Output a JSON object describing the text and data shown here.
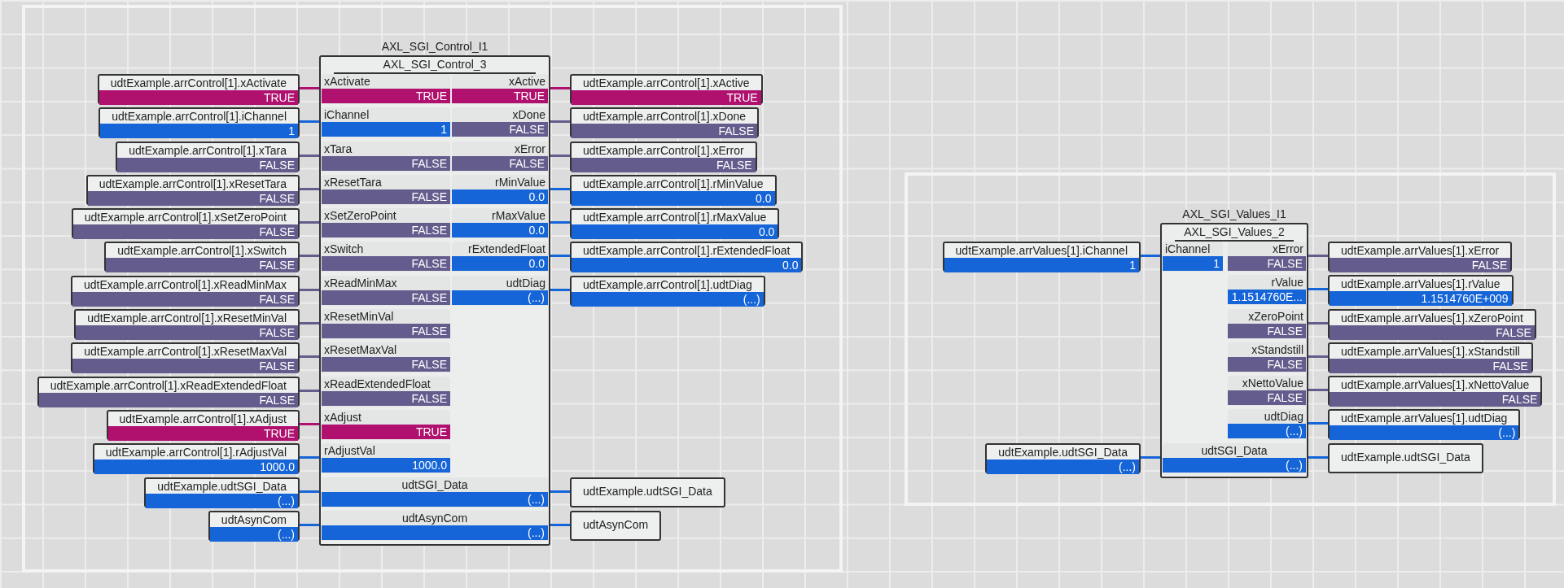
{
  "networks": [
    {
      "block": {
        "instance": "AXL_SGI_Control_I1",
        "type": "AXL_SGI_Control_3",
        "inputs": [
          {
            "name": "xActivate",
            "value": "TRUE",
            "kind": "bool",
            "on": true,
            "variable": {
              "name": "udtExample.arrControl[1].xActivate",
              "value": "TRUE"
            }
          },
          {
            "name": "iChannel",
            "value": "1",
            "kind": "number",
            "variable": {
              "name": "udtExample.arrControl[1].iChannel",
              "value": "1"
            }
          },
          {
            "name": "xTara",
            "value": "FALSE",
            "kind": "bool",
            "on": false,
            "variable": {
              "name": "udtExample.arrControl[1].xTara",
              "value": "FALSE"
            }
          },
          {
            "name": "xResetTara",
            "value": "FALSE",
            "kind": "bool",
            "on": false,
            "variable": {
              "name": "udtExample.arrControl[1].xResetTara",
              "value": "FALSE"
            }
          },
          {
            "name": "xSetZeroPoint",
            "value": "FALSE",
            "kind": "bool",
            "on": false,
            "variable": {
              "name": "udtExample.arrControl[1].xSetZeroPoint",
              "value": "FALSE"
            }
          },
          {
            "name": "xSwitch",
            "value": "FALSE",
            "kind": "bool",
            "on": false,
            "variable": {
              "name": "udtExample.arrControl[1].xSwitch",
              "value": "FALSE"
            }
          },
          {
            "name": "xReadMinMax",
            "value": "FALSE",
            "kind": "bool",
            "on": false,
            "variable": {
              "name": "udtExample.arrControl[1].xReadMinMax",
              "value": "FALSE"
            }
          },
          {
            "name": "xResetMinVal",
            "value": "FALSE",
            "kind": "bool",
            "on": false,
            "variable": {
              "name": "udtExample.arrControl[1].xResetMinVal",
              "value": "FALSE"
            }
          },
          {
            "name": "xResetMaxVal",
            "value": "FALSE",
            "kind": "bool",
            "on": false,
            "variable": {
              "name": "udtExample.arrControl[1].xResetMaxVal",
              "value": "FALSE"
            }
          },
          {
            "name": "xReadExtendedFloat",
            "value": "FALSE",
            "kind": "bool",
            "on": false,
            "variable": {
              "name": "udtExample.arrControl[1].xReadExtendedFloat",
              "value": "FALSE"
            }
          },
          {
            "name": "xAdjust",
            "value": "TRUE",
            "kind": "bool",
            "on": true,
            "variable": {
              "name": "udtExample.arrControl[1].xAdjust",
              "value": "TRUE"
            }
          },
          {
            "name": "rAdjustVal",
            "value": "1000.0",
            "kind": "number",
            "variable": {
              "name": "udtExample.arrControl[1].rAdjustVal",
              "value": "1000.0"
            }
          }
        ],
        "outputs": [
          {
            "name": "xActive",
            "value": "TRUE",
            "kind": "bool",
            "on": true,
            "variable": {
              "name": "udtExample.arrControl[1].xActive",
              "value": "TRUE"
            }
          },
          {
            "name": "xDone",
            "value": "FALSE",
            "kind": "bool",
            "on": false,
            "variable": {
              "name": "udtExample.arrControl[1].xDone",
              "value": "FALSE"
            }
          },
          {
            "name": "xError",
            "value": "FALSE",
            "kind": "bool",
            "on": false,
            "variable": {
              "name": "udtExample.arrControl[1].xError",
              "value": "FALSE"
            }
          },
          {
            "name": "rMinValue",
            "value": "0.0",
            "kind": "number",
            "variable": {
              "name": "udtExample.arrControl[1].rMinValue",
              "value": "0.0"
            }
          },
          {
            "name": "rMaxValue",
            "value": "0.0",
            "kind": "number",
            "variable": {
              "name": "udtExample.arrControl[1].rMaxValue",
              "value": "0.0"
            }
          },
          {
            "name": "rExtendedFloat",
            "value": "0.0",
            "kind": "number",
            "variable": {
              "name": "udtExample.arrControl[1].rExtendedFloat",
              "value": "0.0"
            }
          },
          {
            "name": "udtDiag",
            "value": "(...)",
            "kind": "number",
            "variable": {
              "name": "udtExample.arrControl[1].udtDiag",
              "value": "(...)"
            }
          }
        ],
        "in_outs": [
          {
            "name": "udtSGI_Data",
            "value": "(...)",
            "kind": "number",
            "input": {
              "name": "udtExample.udtSGI_Data",
              "value": "(...)"
            },
            "output": {
              "name": "udtExample.udtSGI_Data"
            }
          },
          {
            "name": "udtAsynCom",
            "value": "(...)",
            "kind": "number",
            "input": {
              "name": "udtAsynCom",
              "value": "(...)"
            },
            "output": {
              "name": "udtAsynCom"
            }
          }
        ]
      }
    },
    {
      "block": {
        "instance": "AXL_SGI_Values_I1",
        "type": "AXL_SGI_Values_2",
        "inputs": [
          {
            "name": "iChannel",
            "value": "1",
            "kind": "number",
            "variable": {
              "name": "udtExample.arrValues[1].iChannel",
              "value": "1"
            }
          }
        ],
        "outputs": [
          {
            "name": "xError",
            "value": "FALSE",
            "kind": "bool",
            "on": false,
            "variable": {
              "name": "udtExample.arrValues[1].xError",
              "value": "FALSE"
            }
          },
          {
            "name": "rValue",
            "value": "1.1514760E...",
            "kind": "number",
            "variable": {
              "name": "udtExample.arrValues[1].rValue",
              "value": "1.1514760E+009"
            }
          },
          {
            "name": "xZeroPoint",
            "value": "FALSE",
            "kind": "bool",
            "on": false,
            "variable": {
              "name": "udtExample.arrValues[1].xZeroPoint",
              "value": "FALSE"
            }
          },
          {
            "name": "xStandstill",
            "value": "FALSE",
            "kind": "bool",
            "on": false,
            "variable": {
              "name": "udtExample.arrValues[1].xStandstill",
              "value": "FALSE"
            }
          },
          {
            "name": "xNettoValue",
            "value": "FALSE",
            "kind": "bool",
            "on": false,
            "variable": {
              "name": "udtExample.arrValues[1].xNettoValue",
              "value": "FALSE"
            }
          },
          {
            "name": "udtDiag",
            "value": "(...)",
            "kind": "number",
            "variable": {
              "name": "udtExample.arrValues[1].udtDiag",
              "value": "(...)"
            }
          }
        ],
        "in_outs": [
          {
            "name": "udtSGI_Data",
            "value": "(...)",
            "kind": "number",
            "input": {
              "name": "udtExample.udtSGI_Data",
              "value": "(...)"
            },
            "output": {
              "name": "udtExample.udtSGI_Data"
            }
          }
        ]
      }
    }
  ]
}
